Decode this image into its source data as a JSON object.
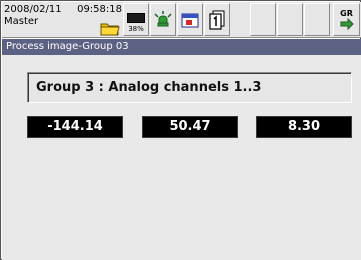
{
  "status": {
    "date": "2008/02/11",
    "time": "09:58:18",
    "user": "Master",
    "memory_label": "38%",
    "transfer_label": "GR"
  },
  "screen": {
    "title": "Process image-Group 03",
    "group_label": "Group 3 : Analog channels 1..3",
    "channels": [
      "-144.14",
      "50.47",
      "8.30"
    ]
  },
  "colors": {
    "title_bar": "#5c6284",
    "value_bg": "#000000",
    "value_text": "#ffffff"
  },
  "icons": [
    "folder-icon",
    "memory-icon",
    "alarm-icon",
    "calendar-icon",
    "page-icon",
    "transfer-icon"
  ]
}
